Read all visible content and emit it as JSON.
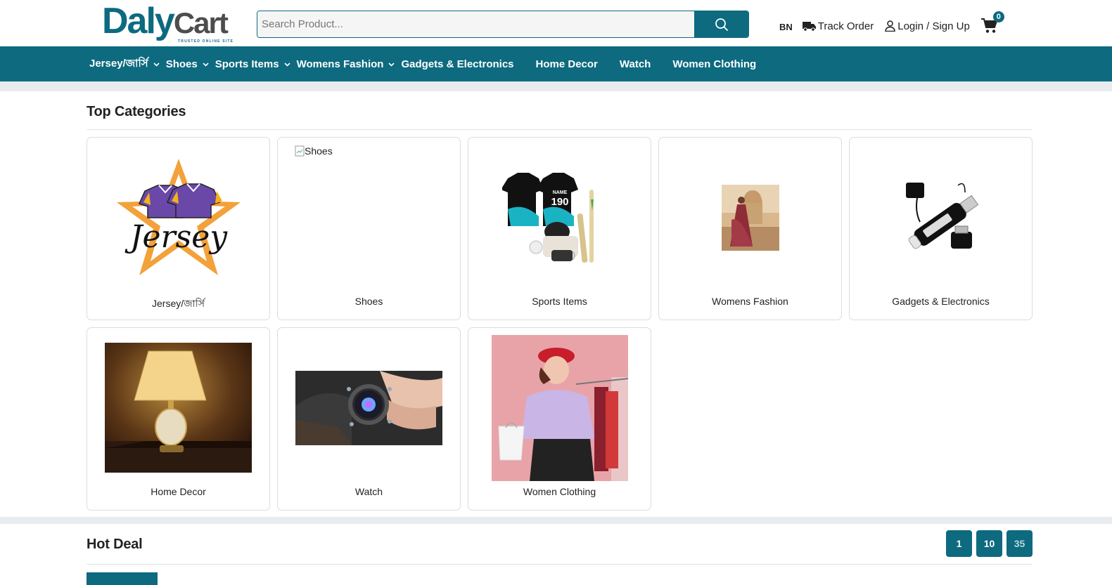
{
  "brand": {
    "name_part1": "Daly",
    "name_part2": "Cart",
    "tagline": "TRUSTED ONLINE SITE"
  },
  "search": {
    "placeholder": "Search Product..."
  },
  "header": {
    "lang": "BN",
    "track_order": "Track Order",
    "login": "Login / Sign Up",
    "cart_count": "0"
  },
  "nav": {
    "items": [
      {
        "label": "Jersey/জার্সি",
        "has_dropdown": true
      },
      {
        "label": "Shoes",
        "has_dropdown": true
      },
      {
        "label": "Sports Items",
        "has_dropdown": true
      },
      {
        "label": "Womens Fashion",
        "has_dropdown": true
      },
      {
        "label": "Gadgets & Electronics",
        "has_dropdown": false
      },
      {
        "label": "Home Decor",
        "has_dropdown": false
      },
      {
        "label": "Watch",
        "has_dropdown": false
      },
      {
        "label": "Women Clothing",
        "has_dropdown": false
      }
    ]
  },
  "top_categories": {
    "title": "Top Categories",
    "items": [
      {
        "label": "Jersey/জার্সি",
        "image_text": "Jersey"
      },
      {
        "label": "Shoes",
        "broken_image_alt": "Shoes"
      },
      {
        "label": "Sports Items",
        "image_text": "NAME 190"
      },
      {
        "label": "Womens Fashion"
      },
      {
        "label": "Gadgets & Electronics"
      },
      {
        "label": "Home Decor"
      },
      {
        "label": "Watch"
      },
      {
        "label": "Women Clothing"
      }
    ]
  },
  "hot_deal": {
    "title": "Hot Deal",
    "pages": [
      "1",
      "10",
      "35"
    ]
  },
  "colors": {
    "primary": "#0d6a7f",
    "logo_gray": "#4d4d4d",
    "band": "#e9ecee"
  }
}
